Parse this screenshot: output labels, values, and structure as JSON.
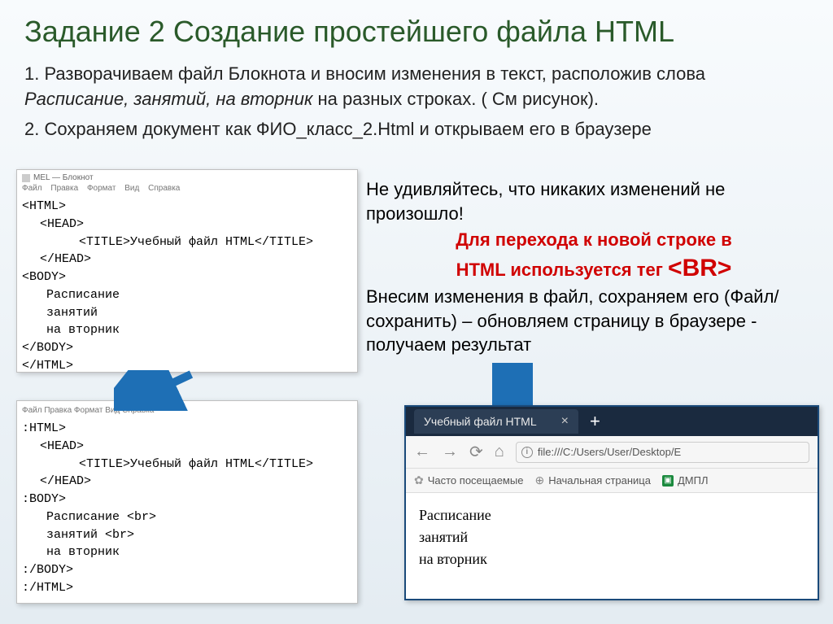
{
  "title": "Задание 2 Создание простейшего файла HTML",
  "instr1_a": "1. Разворачиваем файл Блокнота и вносим изменения в текст, расположив слова ",
  "instr1_b": "Расписание, занятий, на вторник",
  "instr1_c": " на разных строках. ( См рисунок).",
  "instr2": "2. Сохраняем документ как ФИО_класс_2.Html и открываем его в браузере",
  "notepad": {
    "title": "MEL — Блокнот",
    "menu": {
      "m1": "Файл",
      "m2": "Правка",
      "m3": "Формат",
      "m4": "Вид",
      "m5": "Справка"
    },
    "code1": {
      "l1": "<HTML>",
      "l2": "<HEAD>",
      "l3": "<TITLE>Учебный файл HTML</TITLE>",
      "l4": "</HEAD>",
      "l5": "<BODY>",
      "l6": "Расписание",
      "l7": "занятий",
      "l8": "на вторник",
      "l9": "</BODY>",
      "l10": "</HTML>"
    },
    "title2": "Файл  Правка  Формат  Вид  Справка",
    "code2": {
      "l1": ":HTML>",
      "l2": "<HEAD>",
      "l3": "<TITLE>Учебный файл HTML</TITLE>",
      "l4": "</HEAD>",
      "l5": ":BODY>",
      "l6": "Расписание <br>",
      "l7": "занятий <br>",
      "l8": "на вторник",
      "l9": ":/BODY>",
      "l10": ":/HTML>"
    }
  },
  "side": {
    "t1": "Не удивляйтесь, что никаких изменений не произошло!",
    "t2a": "Для перехода к новой строке в",
    "t2b": "HTML используется тег ",
    "t2c": "<BR>",
    "t3": "Внесим изменения в файл, сохраняем его (Файл/сохранить) – обновляем страницу в браузере - получаем результат"
  },
  "browser": {
    "tab": "Учебный файл HTML",
    "url": "file:///C:/Users/User/Desktop/E",
    "bm1": "Часто посещаемые",
    "bm2": "Начальная страница",
    "bm3": "ДМПЛ",
    "content": {
      "l1": "Расписание",
      "l2": "занятий",
      "l3": "на вторник"
    }
  }
}
